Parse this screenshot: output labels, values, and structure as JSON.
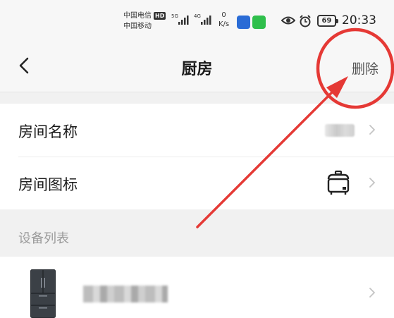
{
  "status_bar": {
    "carrier_1": "中国电信",
    "carrier_1_badge": "HD",
    "carrier_2": "中国移动",
    "net_speed_value": "0",
    "net_speed_unit": "K/s",
    "battery": "69",
    "time": "20:33"
  },
  "header": {
    "title": "厨房",
    "delete_label": "删除"
  },
  "settings": {
    "room_name_label": "房间名称",
    "room_icon_label": "房间图标"
  },
  "device_list": {
    "section_title": "设备列表"
  },
  "annotation": {
    "color": "#e53935"
  }
}
